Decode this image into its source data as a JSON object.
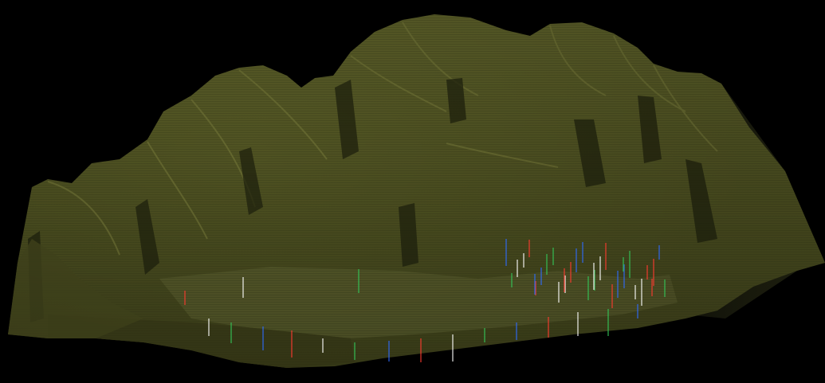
{
  "scene": {
    "background_color": "#000000",
    "terrain_base_color": "#4f5222",
    "terrain_light_color": "#6b6e33",
    "terrain_dark_color": "#2a2c12",
    "marker_colors": [
      "#ff3b30",
      "#ffffff",
      "#34c759",
      "#2f6bff"
    ]
  }
}
